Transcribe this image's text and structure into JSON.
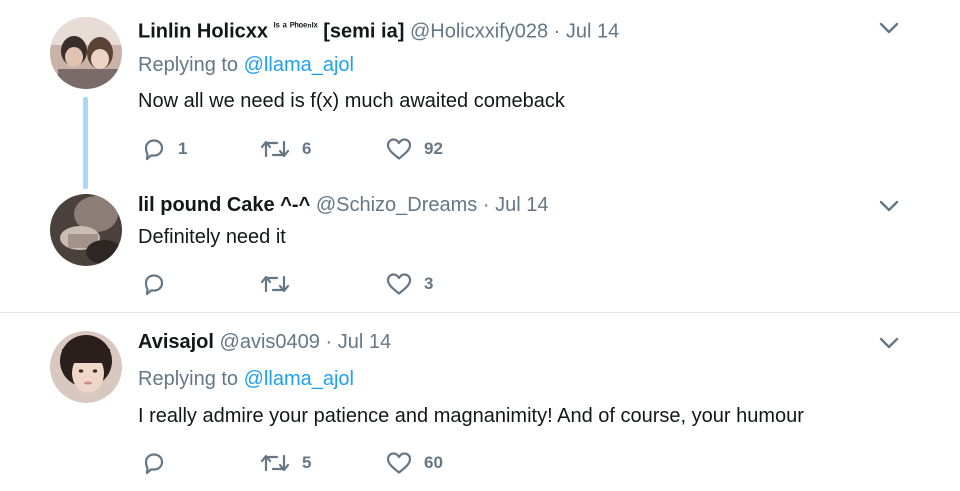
{
  "tweets": [
    {
      "name": "Linlin Holicxx",
      "name_sup": "ᴵˢ ᵃ ᴾʰᵒᵉⁿᴵˣ",
      "name_suffix": "[semi ia]",
      "handle": "@Holicxxify028",
      "dot": "·",
      "date": "Jul 14",
      "replying_prefix": "Replying to ",
      "replying_to": "@llama_ajol",
      "text": "Now all we need is f(x) much awaited comeback",
      "replies": "1",
      "retweets": "6",
      "likes": "92"
    },
    {
      "name": "lil pound Cake ^-^",
      "handle": "@Schizo_Dreams",
      "dot": "·",
      "date": "Jul 14",
      "text": "Definitely need it",
      "likes": "3"
    },
    {
      "name": "Avisajol",
      "handle": "@avis0409",
      "dot": "·",
      "date": "Jul 14",
      "replying_prefix": "Replying to ",
      "replying_to": "@llama_ajol",
      "text": "I really admire your patience and magnanimity! And of course, your humour",
      "retweets": "5",
      "likes": "60"
    }
  ],
  "colors": {
    "accent": "#1da1f2",
    "muted": "#657786",
    "thread": "#a8daf5",
    "divider": "#e1e8ed"
  },
  "icons": [
    "reply-icon",
    "retweet-icon",
    "like-icon",
    "chevron-down-icon"
  ]
}
